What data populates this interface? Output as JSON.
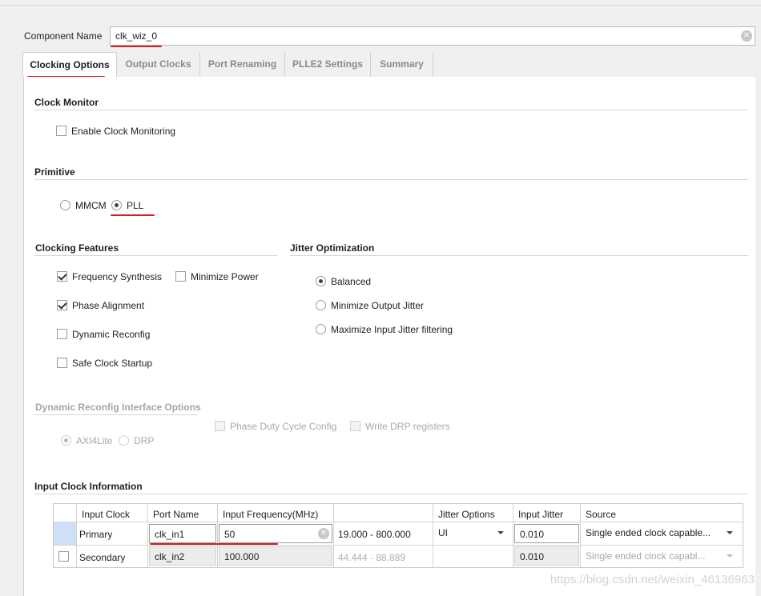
{
  "component": {
    "label": "Component Name",
    "value": "clk_wiz_0"
  },
  "tabs": [
    {
      "label": "Clocking Options",
      "active": true
    },
    {
      "label": "Output Clocks"
    },
    {
      "label": "Port Renaming"
    },
    {
      "label": "PLLE2 Settings"
    },
    {
      "label": "Summary"
    }
  ],
  "clock_monitor": {
    "title": "Clock Monitor",
    "enable_label": "Enable Clock Monitoring",
    "enabled": false
  },
  "primitive": {
    "title": "Primitive",
    "options": [
      "MMCM",
      "PLL"
    ],
    "selected": "PLL"
  },
  "clocking_features": {
    "title": "Clocking Features",
    "frequency_synthesis": "Frequency Synthesis",
    "minimize_power": "Minimize Power",
    "phase_alignment": "Phase Alignment",
    "dynamic_reconfig": "Dynamic Reconfig",
    "safe_clock_startup": "Safe Clock Startup"
  },
  "jitter_optimization": {
    "title": "Jitter Optimization",
    "balanced": "Balanced",
    "minimize_output": "Minimize Output Jitter",
    "maximize_input": "Maximize Input Jitter filtering",
    "selected": "Balanced"
  },
  "dynamic_reconfig_interface": {
    "title": "Dynamic Reconfig Interface Options",
    "axi4lite": "AXI4Lite",
    "drp": "DRP",
    "phase_duty": "Phase Duty Cycle Config",
    "write_drp": "Write DRP registers"
  },
  "input_clock": {
    "title": "Input Clock Information",
    "columns": [
      "Input Clock",
      "Port Name",
      "Input Frequency(MHz)",
      "",
      "Jitter Options",
      "Input Jitter",
      "Source"
    ],
    "rows": [
      {
        "input_clock": "Primary",
        "port_name": "clk_in1",
        "frequency": "50",
        "range": "19.000 - 800.000",
        "jitter_option": "UI",
        "input_jitter": "0.010",
        "source": "Single ended clock capable..."
      },
      {
        "input_clock": "Secondary",
        "port_name": "clk_in2",
        "frequency": "100.000",
        "range": "44.444 - 88.889",
        "jitter_option": "",
        "input_jitter": "0.010",
        "source": "Single ended clock capabl..."
      }
    ]
  },
  "watermark": "https://blog.csdn.net/weixin_46136963",
  "colors": {
    "annotation_red": "#d81e1e"
  }
}
